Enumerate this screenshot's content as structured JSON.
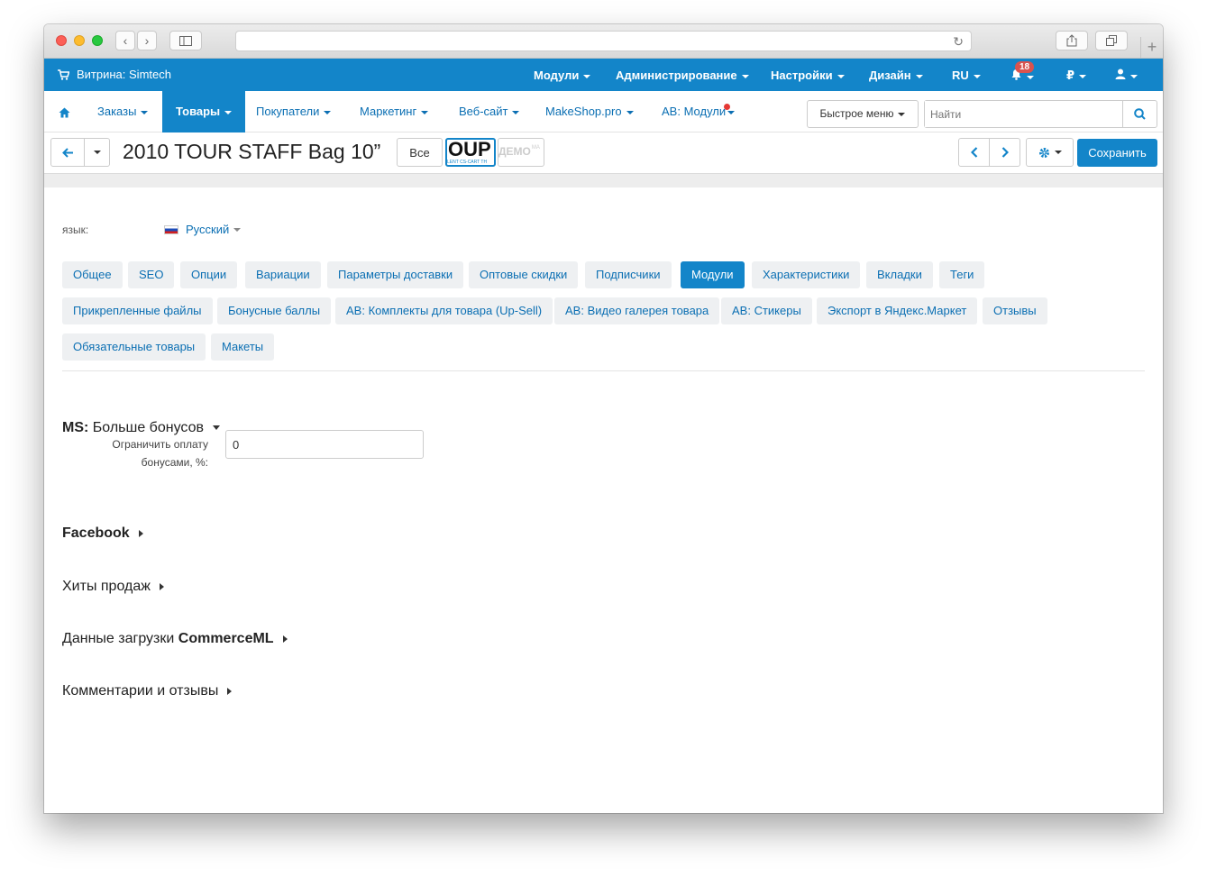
{
  "topbar": {
    "storefront": "Витрина: Simtech",
    "menus": [
      "Модули",
      "Администрирование",
      "Настройки",
      "Дизайн",
      "RU"
    ],
    "notifications_count": "18",
    "currency": "₽",
    "bg_color": "#1385c9"
  },
  "mainnav": {
    "items": [
      "Заказы",
      "Товары",
      "Покупатели",
      "Маркетинг",
      "Веб-сайт",
      "MakeShop.pro",
      "AB: Модули"
    ],
    "active": "Товары",
    "quick_menu": "Быстрое меню",
    "search_placeholder": "Найти"
  },
  "product": {
    "title": "2010 TOUR STAFF Bag 10”",
    "all_button": "Все",
    "thumb1_text": "OUP",
    "thumb1_sub": "LENT CS-CART TH",
    "thumb2_text": "ДЕМО",
    "thumb2_sub": "MA",
    "save_button": "Сохранить"
  },
  "content": {
    "language_label": "язык:",
    "language_value": "Русский",
    "tabs": [
      "Общее",
      "SEO",
      "Опции",
      "Вариации",
      "Параметры доставки",
      "Оптовые скидки",
      "Подписчики",
      "Модули",
      "Характеристики",
      "Вкладки",
      "Теги",
      "Прикрепленные файлы",
      "Бонусные баллы",
      "AB: Комплекты для товара (Up-Sell)",
      "AB: Видео галерея товара",
      "AB: Стикеры",
      "Экспорт в Яндекс.Маркет",
      "Отзывы",
      "Обязательные товары",
      "Макеты"
    ],
    "active_tab": "Модули",
    "sections": {
      "ms_prefix": "MS:",
      "ms_title": "Больше бонусов",
      "facebook": "Facebook",
      "bestsellers": "Хиты продаж",
      "commerceml_prefix": "Данные загрузки",
      "commerceml_bold": "CommerceML",
      "comments": "Комментарии и отзывы"
    },
    "bonus_field": {
      "label_line1": "Ограничить оплату",
      "label_line2": "бонусами, %:",
      "value": "0"
    }
  }
}
